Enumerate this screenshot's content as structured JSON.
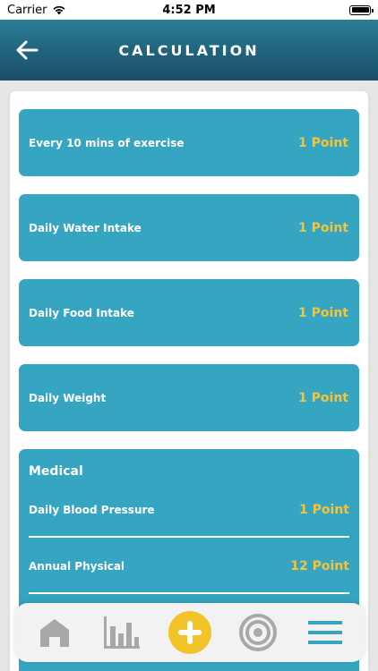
{
  "status_bar": {
    "carrier": "Carrier",
    "time": "4:52 PM"
  },
  "header": {
    "title": "CALCULATION"
  },
  "cards": [
    {
      "label": "Every 10 mins of exercise",
      "value": "1 Point"
    },
    {
      "label": "Daily Water Intake",
      "value": "1 Point"
    },
    {
      "label": "Daily Food Intake",
      "value": "1 Point"
    },
    {
      "label": "Daily Weight",
      "value": "1 Point"
    }
  ],
  "medical": {
    "title": "Medical",
    "items": [
      {
        "label": "Daily Blood Pressure",
        "value": "1 Point"
      },
      {
        "label": "Annual Physical",
        "value": "12 Point"
      }
    ]
  },
  "tab_bar": {
    "icons": [
      "home-icon",
      "bar-chart-icon",
      "plus-icon",
      "target-icon",
      "menu-icon"
    ]
  },
  "colors": {
    "header": "#1e6078",
    "card": "#35a5c1",
    "point_value": "#f5c43a",
    "plus_button": "#f3c42a",
    "tab_icon": "#a8a8a8",
    "menu_icon": "#35a5c1"
  }
}
